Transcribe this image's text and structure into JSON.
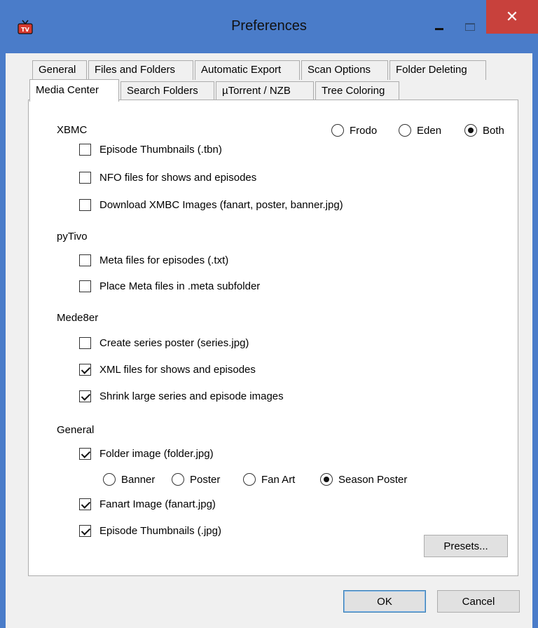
{
  "window": {
    "title": "Preferences",
    "icon": "tv-app-icon",
    "close_glyph": "✕"
  },
  "tabs": {
    "row1": [
      "General",
      "Files and Folders",
      "Automatic Export",
      "Scan Options",
      "Folder Deleting"
    ],
    "row2": [
      "Media Center",
      "Search Folders",
      "µTorrent / NZB",
      "Tree Coloring"
    ],
    "active": "Media Center"
  },
  "xbmc": {
    "label": "XBMC",
    "versions": [
      {
        "label": "Frodo",
        "selected": false
      },
      {
        "label": "Eden",
        "selected": false
      },
      {
        "label": "Both",
        "selected": true
      }
    ],
    "options": [
      {
        "label": "Episode Thumbnails (.tbn)",
        "checked": false
      },
      {
        "label": "NFO files for shows and episodes",
        "checked": false
      },
      {
        "label": "Download XMBC Images (fanart, poster, banner.jpg)",
        "checked": false
      }
    ]
  },
  "pytivo": {
    "label": "pyTivo",
    "options": [
      {
        "label": "Meta files for episodes (.txt)",
        "checked": false
      },
      {
        "label": "Place Meta files in .meta subfolder",
        "checked": false
      }
    ]
  },
  "mede8er": {
    "label": "Mede8er",
    "options": [
      {
        "label": "Create series poster (series.jpg)",
        "checked": false
      },
      {
        "label": "XML files for shows and episodes",
        "checked": true
      },
      {
        "label": "Shrink large series and episode images",
        "checked": true
      }
    ]
  },
  "general": {
    "label": "General",
    "folder_image": {
      "label": "Folder image (folder.jpg)",
      "checked": true
    },
    "folder_image_types": [
      {
        "label": "Banner",
        "selected": false
      },
      {
        "label": "Poster",
        "selected": false
      },
      {
        "label": "Fan Art",
        "selected": false
      },
      {
        "label": "Season Poster",
        "selected": true
      }
    ],
    "fanart": {
      "label": "Fanart Image (fanart.jpg)",
      "checked": true
    },
    "thumbnails": {
      "label": "Episode Thumbnails (.jpg)",
      "checked": true
    }
  },
  "buttons": {
    "presets": "Presets...",
    "ok": "OK",
    "cancel": "Cancel"
  }
}
